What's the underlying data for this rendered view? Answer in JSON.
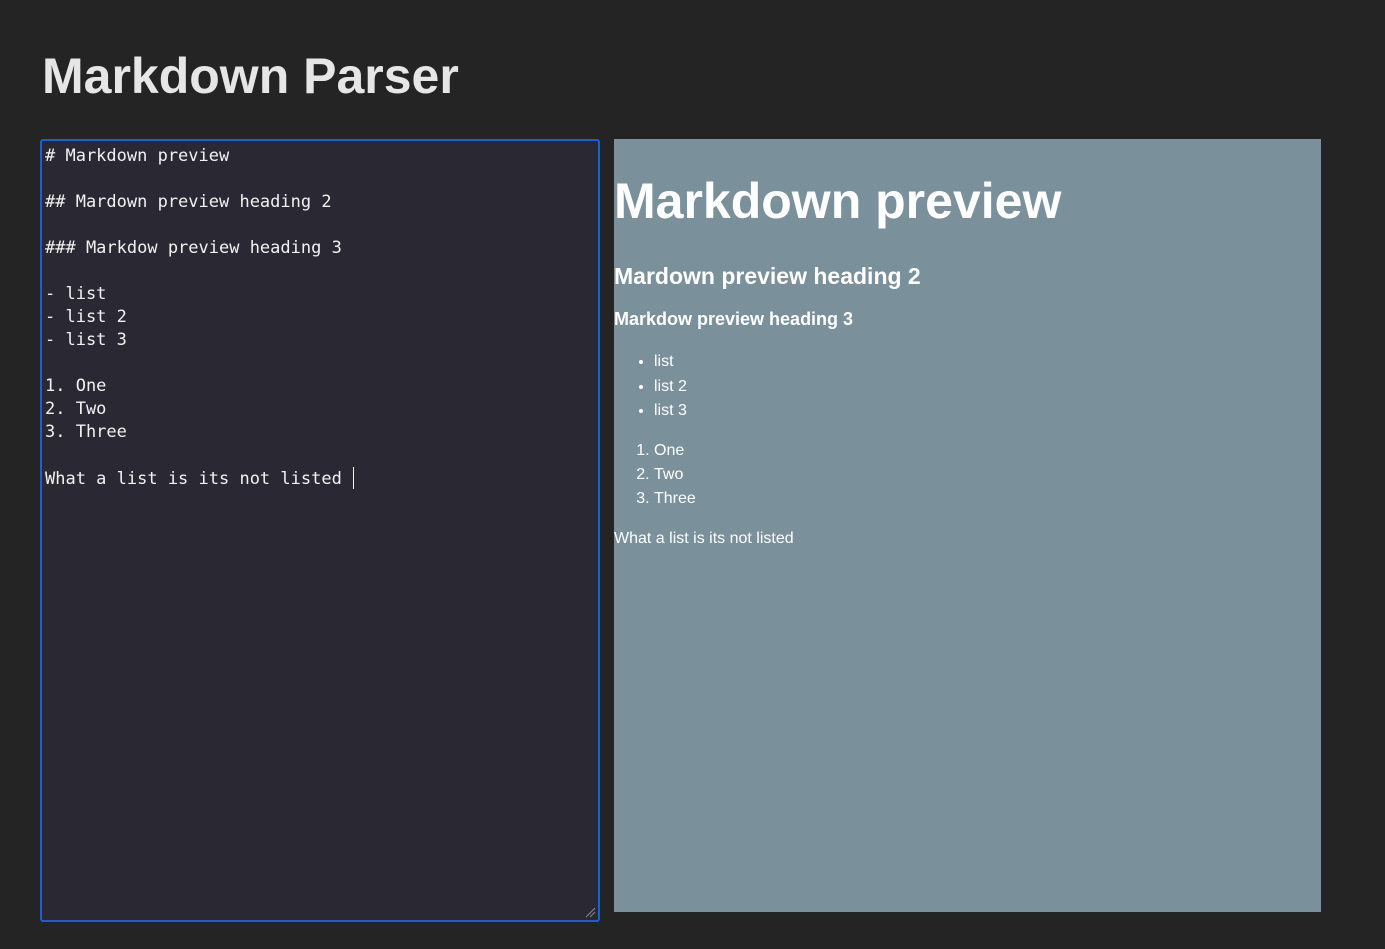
{
  "header": {
    "title": "Markdown Parser"
  },
  "editor": {
    "lines": [
      "# Markdown preview",
      "",
      "## Mardown preview heading 2",
      "",
      "### Markdow preview heading 3",
      "",
      "- list",
      "- list 2",
      "- list 3",
      "",
      "1. One",
      "2. Two",
      "3. Three",
      "",
      "What a list is its not listed"
    ],
    "border_color": "#1a5fd6",
    "background": "#2a2933"
  },
  "preview": {
    "h1": "Markdown preview",
    "h2": "Mardown preview heading 2",
    "h3": "Markdow preview heading 3",
    "bullets": [
      "list",
      "list 2",
      "list 3"
    ],
    "numbered": [
      "One",
      "Two",
      "Three"
    ],
    "paragraph": "What a list is its not listed",
    "background": "#7a919b"
  },
  "colors": {
    "page_background": "#242424",
    "title_text": "#e6e6e6"
  }
}
